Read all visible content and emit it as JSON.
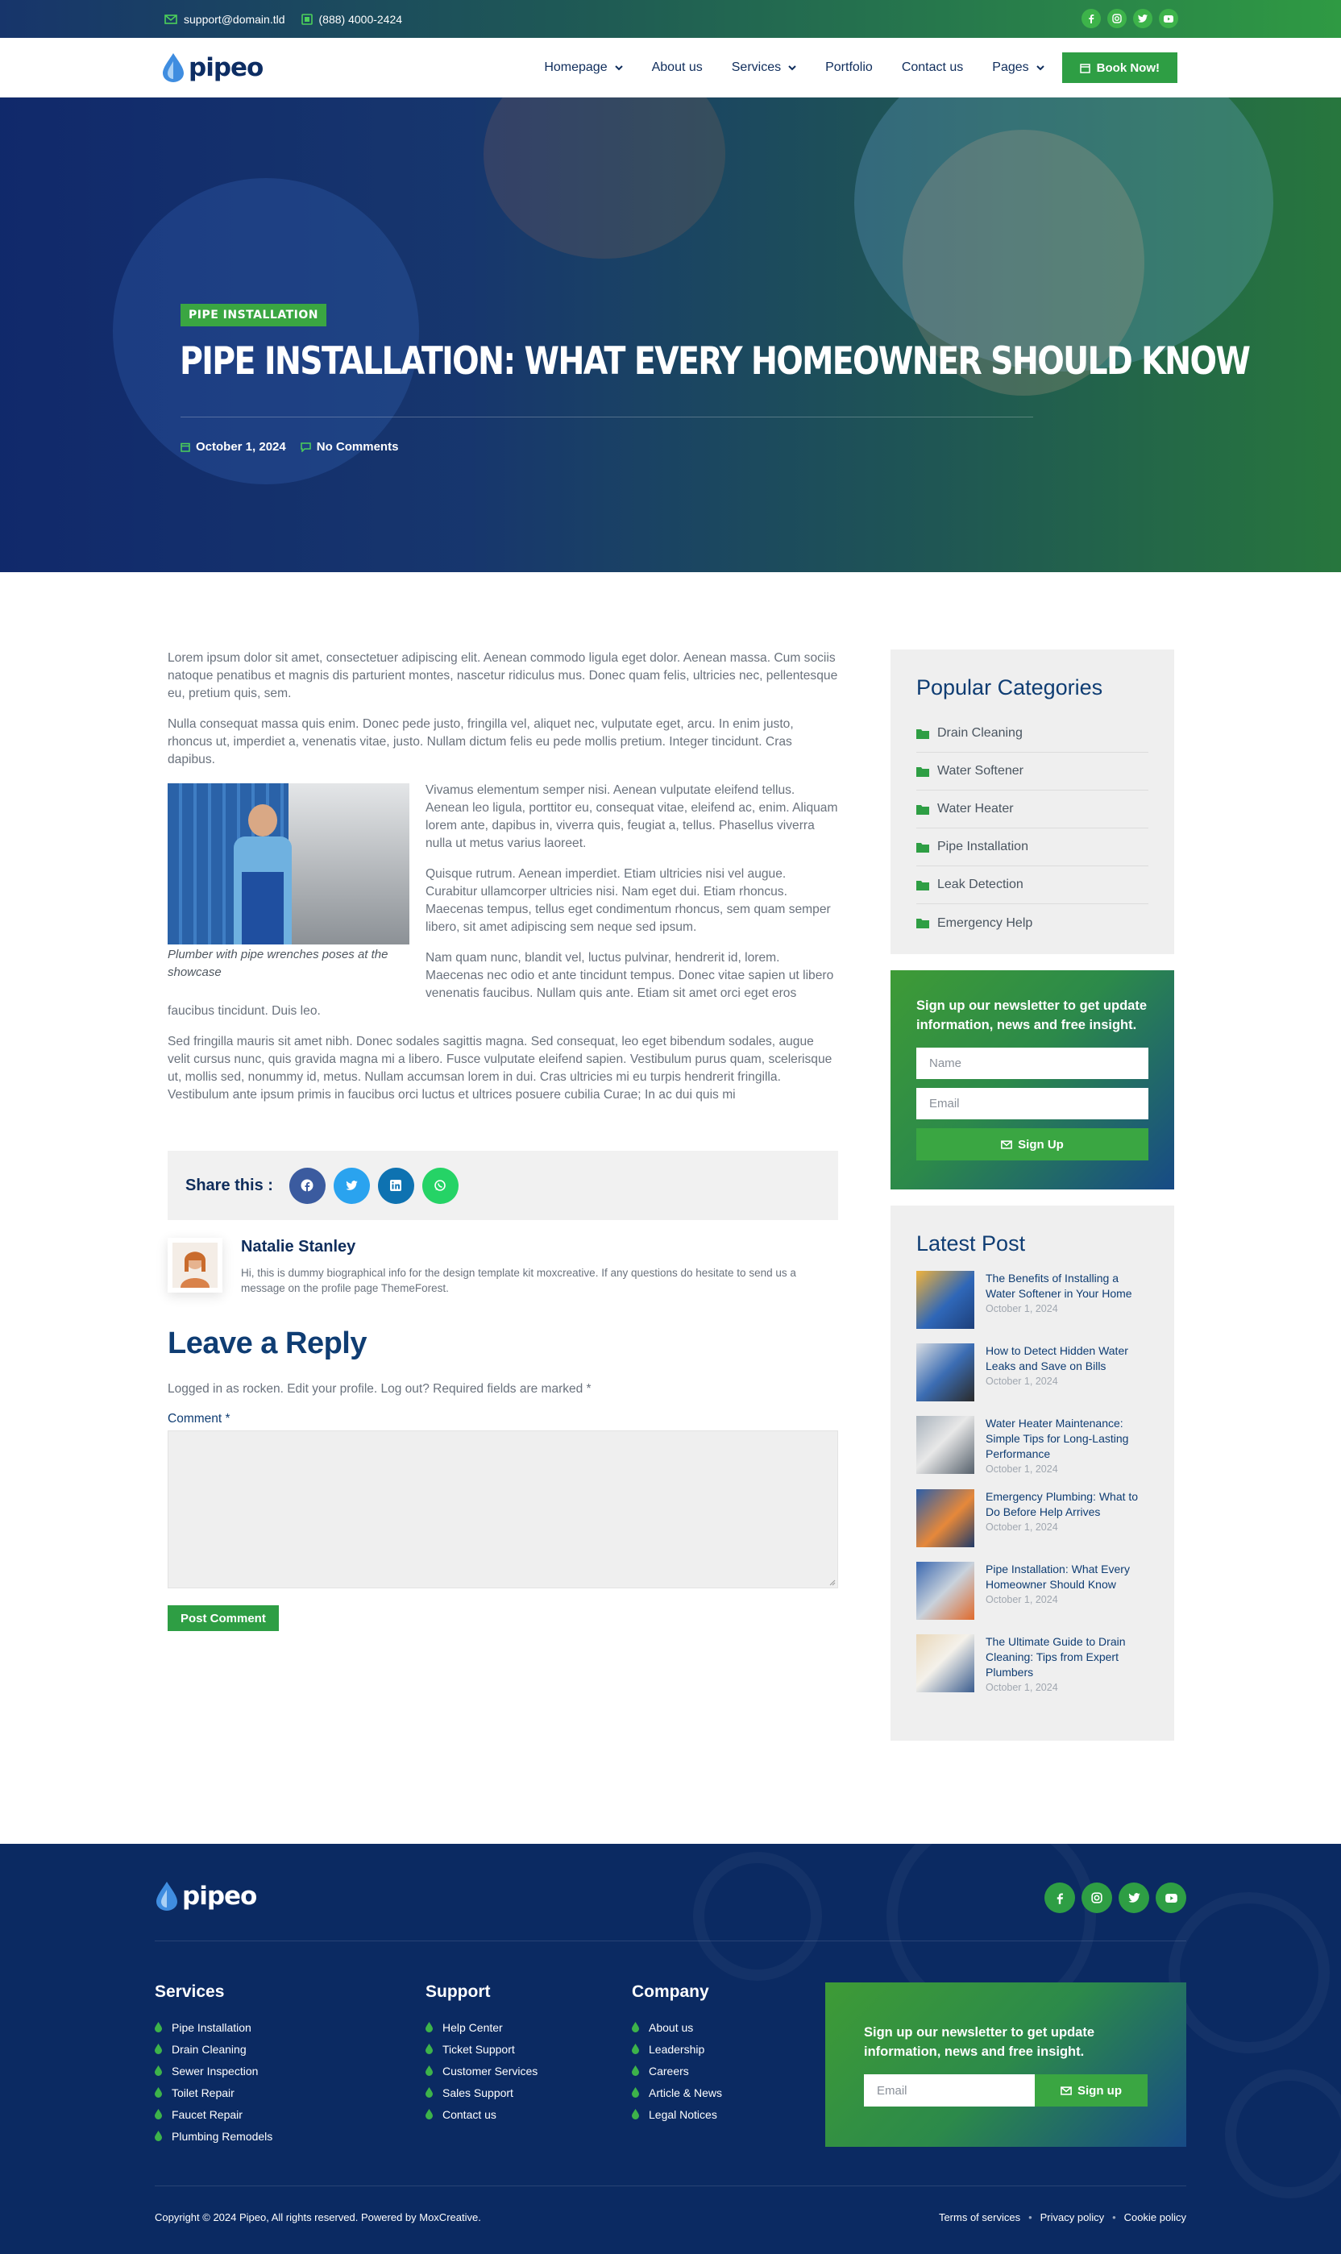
{
  "colors": {
    "navy": "#0f2d5c",
    "green": "#2e9e44",
    "footer_bg": "#0b2a62"
  },
  "topbar": {
    "email": "support@domain.tld",
    "phone": "(888) 4000-2424",
    "socials": [
      "facebook-icon",
      "instagram-icon",
      "twitter-icon",
      "youtube-icon"
    ]
  },
  "brand": {
    "name": "pipeo"
  },
  "nav": {
    "items": [
      {
        "label": "Homepage",
        "dropdown": true
      },
      {
        "label": "About us",
        "dropdown": false
      },
      {
        "label": "Services",
        "dropdown": true
      },
      {
        "label": "Portfolio",
        "dropdown": false
      },
      {
        "label": "Contact us",
        "dropdown": false
      },
      {
        "label": "Pages",
        "dropdown": true
      }
    ],
    "cta": "Book Now!"
  },
  "hero": {
    "tag": "PIPE INSTALLATION",
    "title": "PIPE INSTALLATION: WHAT EVERY HOMEOWNER SHOULD KNOW",
    "date": "October 1, 2024",
    "comments": "No Comments"
  },
  "article": {
    "p1": "Lorem ipsum dolor sit amet, consectetuer adipiscing elit. Aenean commodo ligula eget dolor. Aenean massa. Cum sociis natoque penatibus et magnis dis parturient montes, nascetur ridiculus mus. Donec quam felis, ultricies nec, pellentesque eu, pretium quis, sem.",
    "p2": "Nulla consequat massa quis enim. Donec pede justo, fringilla vel, aliquet nec, vulputate eget, arcu. In enim justo, rhoncus ut, imperdiet a, venenatis vitae, justo. Nullam dictum felis eu pede mollis pretium. Integer tincidunt. Cras dapibus.",
    "figure_caption": "Plumber with pipe wrenches poses at the showcase",
    "p3": "Vivamus elementum semper nisi. Aenean vulputate eleifend tellus. Aenean leo ligula, porttitor eu, consequat vitae, eleifend ac, enim. Aliquam lorem ante, dapibus in, viverra quis, feugiat a, tellus. Phasellus viverra nulla ut metus varius laoreet.",
    "p4": "Quisque rutrum. Aenean imperdiet. Etiam ultricies nisi vel augue. Curabitur ullamcorper ultricies nisi. Nam eget dui. Etiam rhoncus. Maecenas tempus, tellus eget condimentum rhoncus, sem quam semper libero, sit amet adipiscing sem neque sed ipsum.",
    "p5": "Nam quam nunc, blandit vel, luctus pulvinar, hendrerit id, lorem. Maecenas nec odio et ante tincidunt tempus. Donec vitae sapien ut libero venenatis faucibus. Nullam quis ante. Etiam sit amet orci eget eros faucibus tincidunt. Duis leo.",
    "p6": "Sed fringilla mauris sit amet nibh. Donec sodales sagittis magna. Sed consequat, leo eget bibendum sodales, augue velit cursus nunc, quis gravida magna mi a libero. Fusce vulputate eleifend sapien. Vestibulum purus quam, scelerisque ut, mollis sed, nonummy id, metus. Nullam accumsan lorem in dui. Cras ultricies mi eu turpis hendrerit fringilla. Vestibulum ante ipsum primis in faucibus orci luctus et ultrices posuere cubilia Curae; In ac dui quis mi"
  },
  "share": {
    "label": "Share this :",
    "buttons": [
      "facebook",
      "twitter",
      "linkedin",
      "whatsapp"
    ]
  },
  "author": {
    "name": "Natalie Stanley",
    "bio": "Hi, this is dummy biographical info for the design template kit moxcreative. If any questions do hesitate to send us a message on the profile page ThemeForest."
  },
  "reply": {
    "heading": "Leave a Reply",
    "note": "Logged in as rocken. Edit your profile. Log out? Required fields are marked *",
    "comment_label": "Comment *",
    "submit": "Post Comment"
  },
  "sidebar": {
    "categories_title": "Popular Categories",
    "categories": [
      "Drain Cleaning",
      "Water Softener",
      "Water Heater",
      "Pipe Installation",
      "Leak Detection",
      "Emergency Help"
    ],
    "newsletter": {
      "text": "Sign up our newsletter to get update information, news and free insight.",
      "name_placeholder": "Name",
      "email_placeholder": "Email",
      "button": "Sign Up"
    },
    "latest_title": "Latest Post",
    "latest": [
      {
        "title": "The Benefits of Installing a Water Softener in Your Home",
        "date": "October 1, 2024"
      },
      {
        "title": "How to Detect Hidden Water Leaks and Save on Bills",
        "date": "October 1, 2024"
      },
      {
        "title": "Water Heater Maintenance: Simple Tips for Long-Lasting Performance",
        "date": "October 1, 2024"
      },
      {
        "title": "Emergency Plumbing: What to Do Before Help Arrives",
        "date": "October 1, 2024"
      },
      {
        "title": "Pipe Installation: What Every Homeowner Should Know",
        "date": "October 1, 2024"
      },
      {
        "title": "The Ultimate Guide to Drain Cleaning: Tips from Expert Plumbers",
        "date": "October 1, 2024"
      }
    ]
  },
  "footer": {
    "services_title": "Services",
    "services": [
      "Pipe Installation",
      "Drain Cleaning",
      "Sewer Inspection",
      "Toilet Repair",
      "Faucet Repair",
      "Plumbing Remodels"
    ],
    "support_title": "Support",
    "support": [
      "Help Center",
      "Ticket Support",
      "Customer Services",
      "Sales Support",
      "Contact us"
    ],
    "company_title": "Company",
    "company": [
      "About us",
      "Leadership",
      "Careers",
      "Article & News",
      "Legal Notices"
    ],
    "newsletter_text": "Sign up our newsletter to get update information, news and free insight.",
    "email_placeholder": "Email",
    "signup": "Sign up",
    "copyright": "Copyright © 2024 Pipeo, All rights reserved. Powered by MoxCreative.",
    "legal": [
      "Terms of services",
      "Privacy policy",
      "Cookie policy"
    ]
  }
}
